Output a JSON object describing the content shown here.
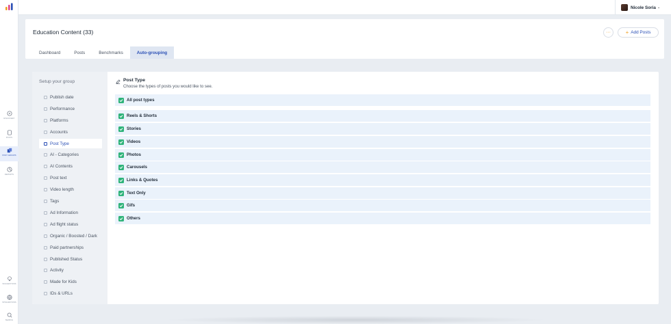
{
  "rail": {
    "items": [
      {
        "name": "discovery",
        "label": "DISCOVERY",
        "icon": "compass-icon"
      },
      {
        "name": "posts",
        "label": "POSTS",
        "icon": "document-icon"
      },
      {
        "name": "post-groups",
        "label": "POST GROUPS",
        "icon": "groups-icon",
        "active": true
      },
      {
        "name": "reports",
        "label": "REPORTS",
        "icon": "chart-icon"
      },
      {
        "name": "suggestions",
        "label": "SUGGESTIONS",
        "icon": "lightbulb-icon"
      },
      {
        "name": "integrations",
        "label": "INTEGRATIONS",
        "icon": "globe-icon"
      },
      {
        "name": "search",
        "label": "SEARCH",
        "icon": "search-icon"
      }
    ]
  },
  "user": {
    "name": "Nicole Soria"
  },
  "header": {
    "title": "Education Content (33)",
    "more_label": "···",
    "add_label": "Add Posts",
    "tabs": [
      {
        "label": "Dashboard"
      },
      {
        "label": "Posts"
      },
      {
        "label": "Benchmarks"
      },
      {
        "label": "Auto-grouping",
        "active": true
      }
    ]
  },
  "sidebar": {
    "title": "Setup your group",
    "items": [
      {
        "label": "Publish date"
      },
      {
        "label": "Performance"
      },
      {
        "label": "Platforms"
      },
      {
        "label": "Accounts"
      },
      {
        "label": "Post Type",
        "active": true
      },
      {
        "label": "AI - Categories"
      },
      {
        "label": "AI Contents"
      },
      {
        "label": "Post text"
      },
      {
        "label": "Video length"
      },
      {
        "label": "Tags"
      },
      {
        "label": "Ad Information"
      },
      {
        "label": "Ad flight status"
      },
      {
        "label": "Organic / Boosted / Dark"
      },
      {
        "label": "Paid partnerships"
      },
      {
        "label": "Published Status"
      },
      {
        "label": "Activity"
      },
      {
        "label": "Made for Kids"
      },
      {
        "label": "IDs & URLs"
      }
    ]
  },
  "main": {
    "title": "Post Type",
    "subtitle": "Choose the types of posts you would like to see.",
    "all_label": "All post types",
    "options": [
      {
        "label": "Reels & Shorts",
        "checked": true
      },
      {
        "label": "Stories",
        "checked": true
      },
      {
        "label": "Videos",
        "checked": true
      },
      {
        "label": "Photos",
        "checked": true
      },
      {
        "label": "Carousels",
        "checked": true
      },
      {
        "label": "Links & Quotes",
        "checked": true
      },
      {
        "label": "Text Only",
        "checked": true
      },
      {
        "label": "Gifs",
        "checked": true
      },
      {
        "label": "Others",
        "checked": true
      }
    ]
  },
  "colors": {
    "accent": "#2a4fb5",
    "check": "#2fb37a",
    "orange": "#f0a020"
  }
}
